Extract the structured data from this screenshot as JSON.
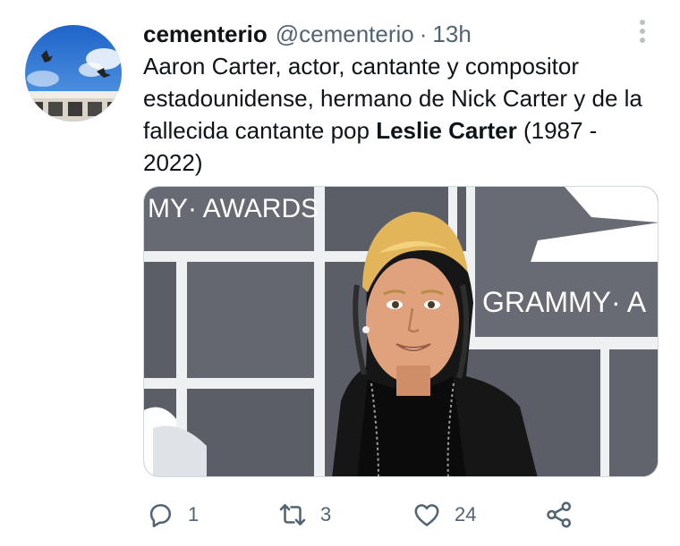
{
  "tweet": {
    "author_name": "cementerio",
    "handle": "@cementerio",
    "separator": "·",
    "time": "13h",
    "text_part1": "Aaron Carter, actor, cantante y compositor estadounidense, hermano de Nick Carter y de la fallecida cantante pop ",
    "text_bold": "Leslie Carter",
    "text_part2": " (1987 - 2022)",
    "media": {
      "backdrop_text_left": "MY· AWARDS",
      "backdrop_text_right": "GRAMMY· A"
    }
  },
  "actions": {
    "reply": {
      "icon": "reply-icon",
      "count": "1"
    },
    "retweet": {
      "icon": "retweet-icon",
      "count": "3"
    },
    "like": {
      "icon": "heart-icon",
      "count": "24"
    },
    "share": {
      "icon": "share-icon"
    }
  },
  "colors": {
    "text": "#0f1419",
    "secondary": "#536471",
    "icon": "#536471",
    "backdrop": "#5b5e66"
  }
}
